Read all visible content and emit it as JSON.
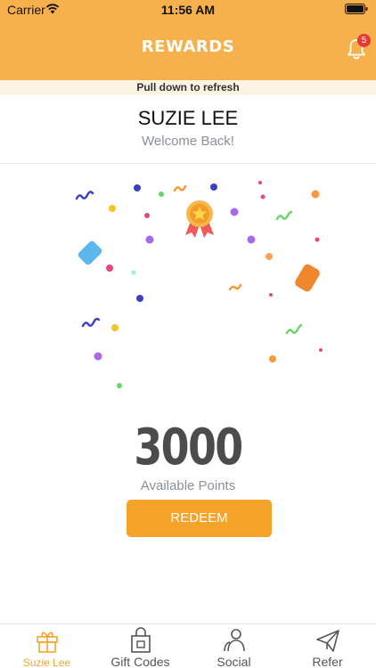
{
  "status_bar": {
    "carrier": "Carrier",
    "time": "11:56 AM"
  },
  "header": {
    "title": "REWARDS",
    "notification_count": "5"
  },
  "refresh_hint": "Pull down to refresh",
  "profile": {
    "name": "SUZIE LEE",
    "greeting": "Welcome Back!"
  },
  "rewards": {
    "points": "3000",
    "points_label": "Available Points",
    "redeem_label": "REDEEM"
  },
  "tabs": [
    {
      "label": "Suzie Lee",
      "icon": "gift-icon",
      "active": true
    },
    {
      "label": "Gift Codes",
      "icon": "shopping-bag-icon",
      "active": false
    },
    {
      "label": "Social",
      "icon": "users-icon",
      "active": false
    },
    {
      "label": "Refer",
      "icon": "paper-plane-icon",
      "active": false
    }
  ],
  "colors": {
    "header": "#f6b14c",
    "accent": "#f6a32a",
    "badge": "#e53935"
  }
}
